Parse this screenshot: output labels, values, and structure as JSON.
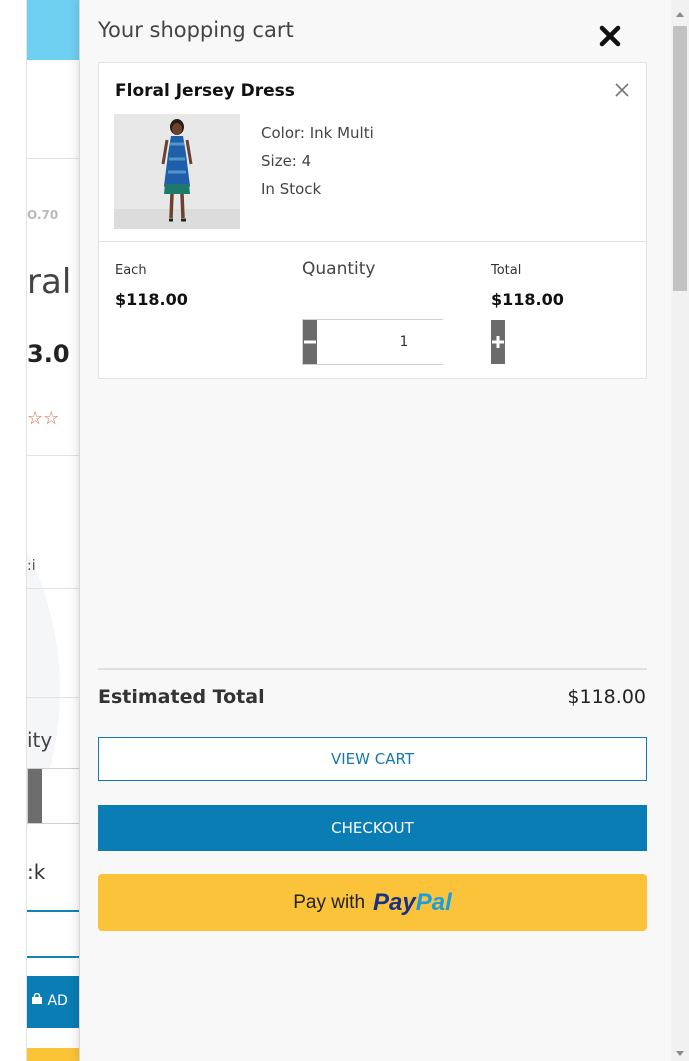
{
  "background_page": {
    "sku_fragment": "O.70",
    "name_fragment": "ral",
    "price_fragment": "3.0",
    "stars": "☆☆",
    "color_fragment": ":i",
    "quantity_fragment": "ity",
    "stock_fragment": ":k",
    "add_button_fragment": "AD"
  },
  "cart": {
    "title": "Your shopping cart",
    "item": {
      "name": "Floral Jersey Dress",
      "color": "Color: Ink Multi",
      "size": "Size: 4",
      "stock": "In Stock",
      "each_label": "Each",
      "each_value": "$118.00",
      "quantity_label": "Quantity",
      "quantity_value": "1",
      "total_label": "Total",
      "total_value": "$118.00"
    },
    "estimated_total_label": "Estimated Total",
    "estimated_total_value": "$118.00",
    "view_cart_label": "VIEW CART",
    "checkout_label": "CHECKOUT",
    "paypal": {
      "prefix": "Pay with",
      "pay": "Pay",
      "pal": "Pal"
    }
  },
  "colors": {
    "checkout_blue": "#0b7db5",
    "paypal_yellow": "#fbc33a",
    "stepper_gray": "#6b6b6b",
    "header_cyan": "#6fd0f1"
  }
}
